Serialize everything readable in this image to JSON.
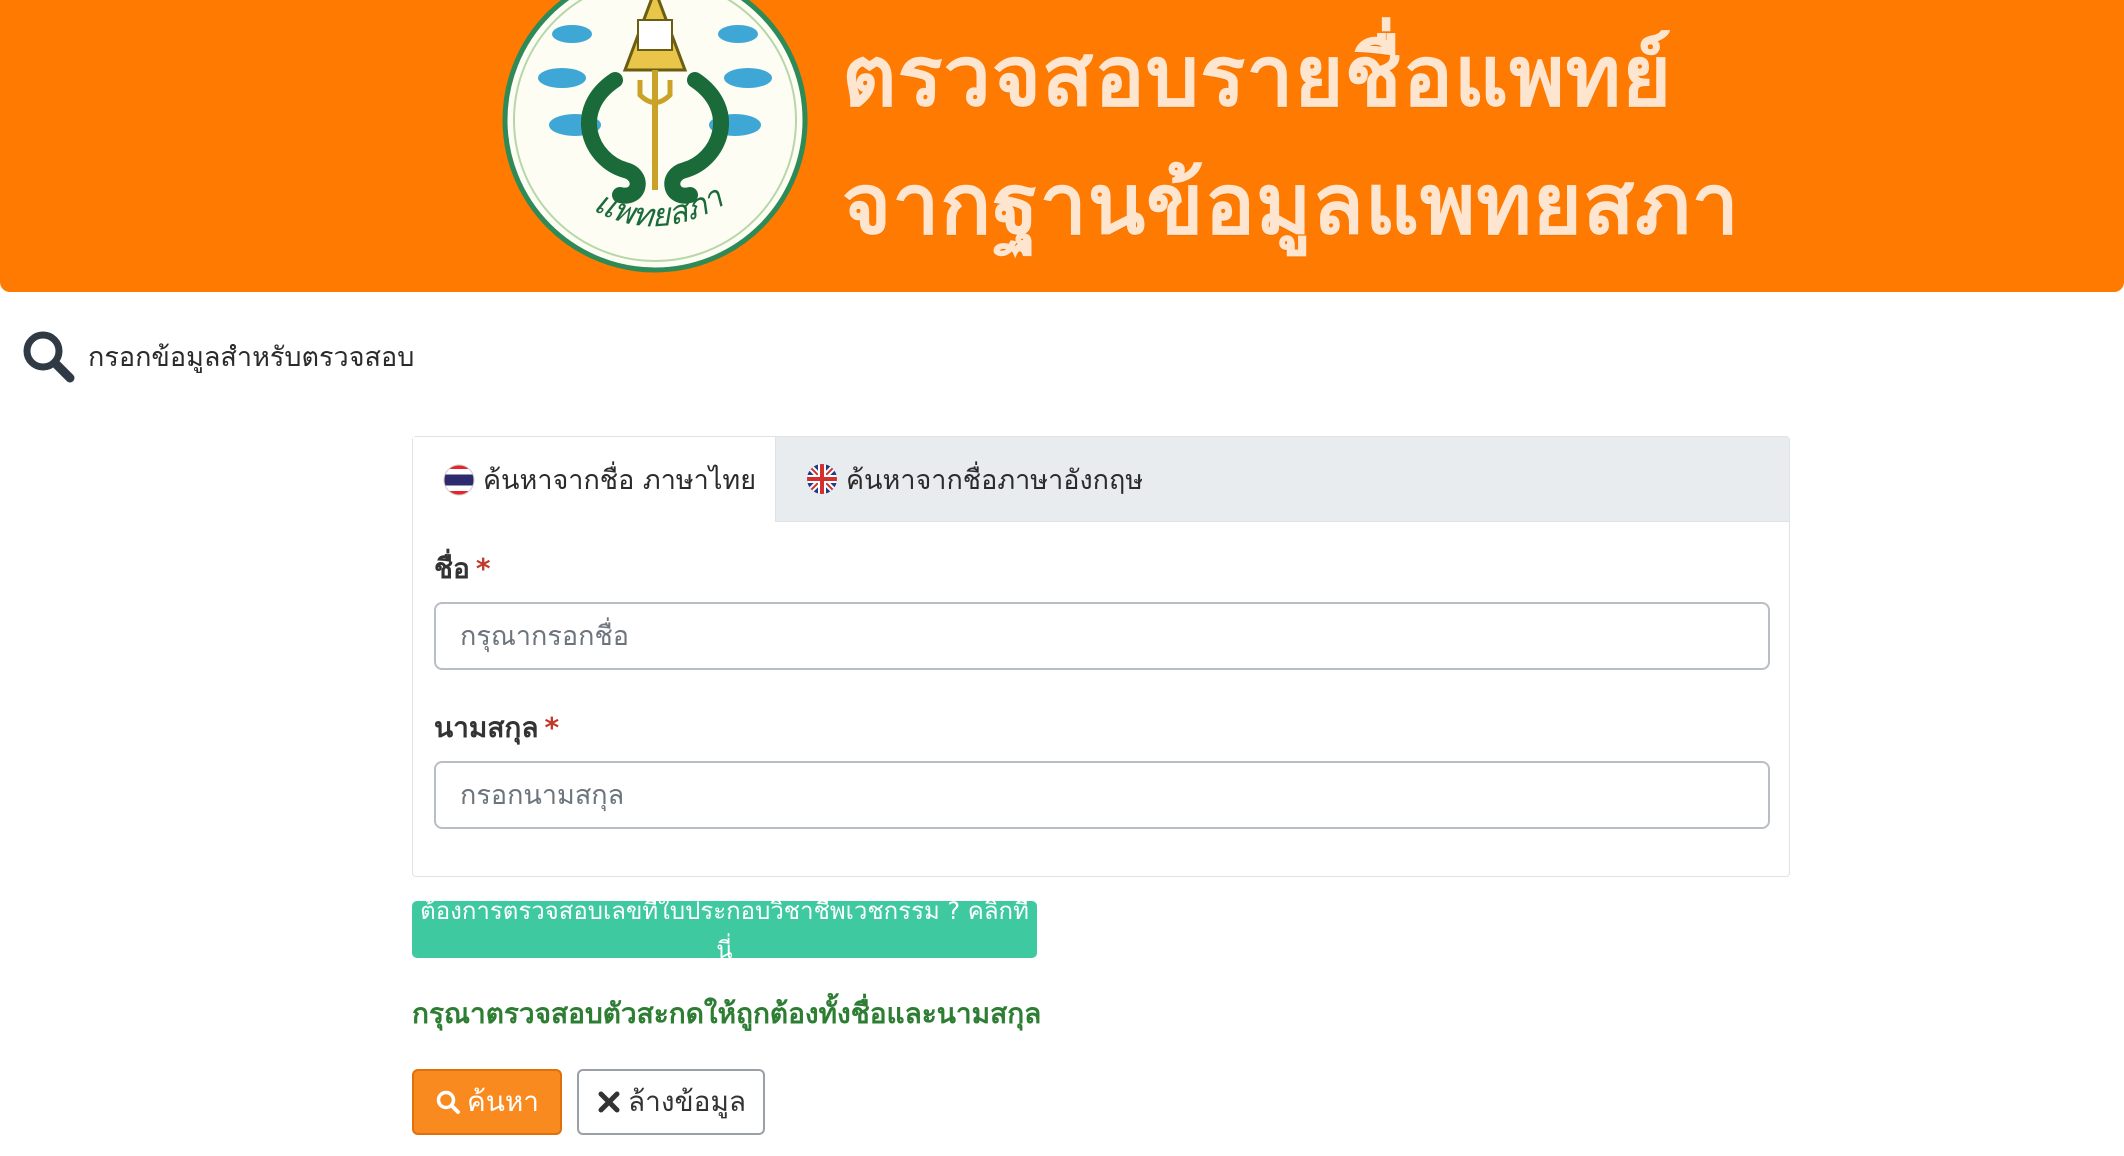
{
  "header": {
    "title_line1": "ตรวจสอบรายชื่อแพทย์",
    "title_line2": "จากฐานข้อมูลแพทยสภา",
    "logo_text": "แพทยสภา",
    "brand_color": "#ff7a00"
  },
  "section": {
    "icon": "search-icon",
    "heading": "กรอกข้อมูลสำหรับตรวจสอบ"
  },
  "tabs": [
    {
      "label": "ค้นหาจากชื่อ ภาษาไทย",
      "icon": "thai-flag-icon",
      "active": true
    },
    {
      "label": "ค้นหาจากชื่อภาษาอังกฤษ",
      "icon": "uk-flag-icon",
      "active": false
    }
  ],
  "form": {
    "first_name_label": "ชื่อ",
    "first_name_required": "*",
    "first_name_placeholder": "กรุณากรอกชื่อ",
    "first_name_value": "",
    "last_name_label": "นามสกุล",
    "last_name_required": "*",
    "last_name_placeholder": "กรอกนามสกุล",
    "last_name_value": ""
  },
  "license_link_label": "ต้องการตรวจสอบเลขที่ใบประกอบวิชาชีพเวชกรรม ? คลิกที่นี่",
  "notice": "กรุณาตรวจสอบตัวสะกดให้ถูกต้องทั้งชื่อและนามสกุล",
  "actions": {
    "search_label": "ค้นหา",
    "clear_label": "ล้างข้อมูล"
  },
  "colors": {
    "accent": "#f98a1f",
    "license_button": "#3fc9a0",
    "notice_text": "#2d7d32",
    "required": "#c0392b"
  }
}
